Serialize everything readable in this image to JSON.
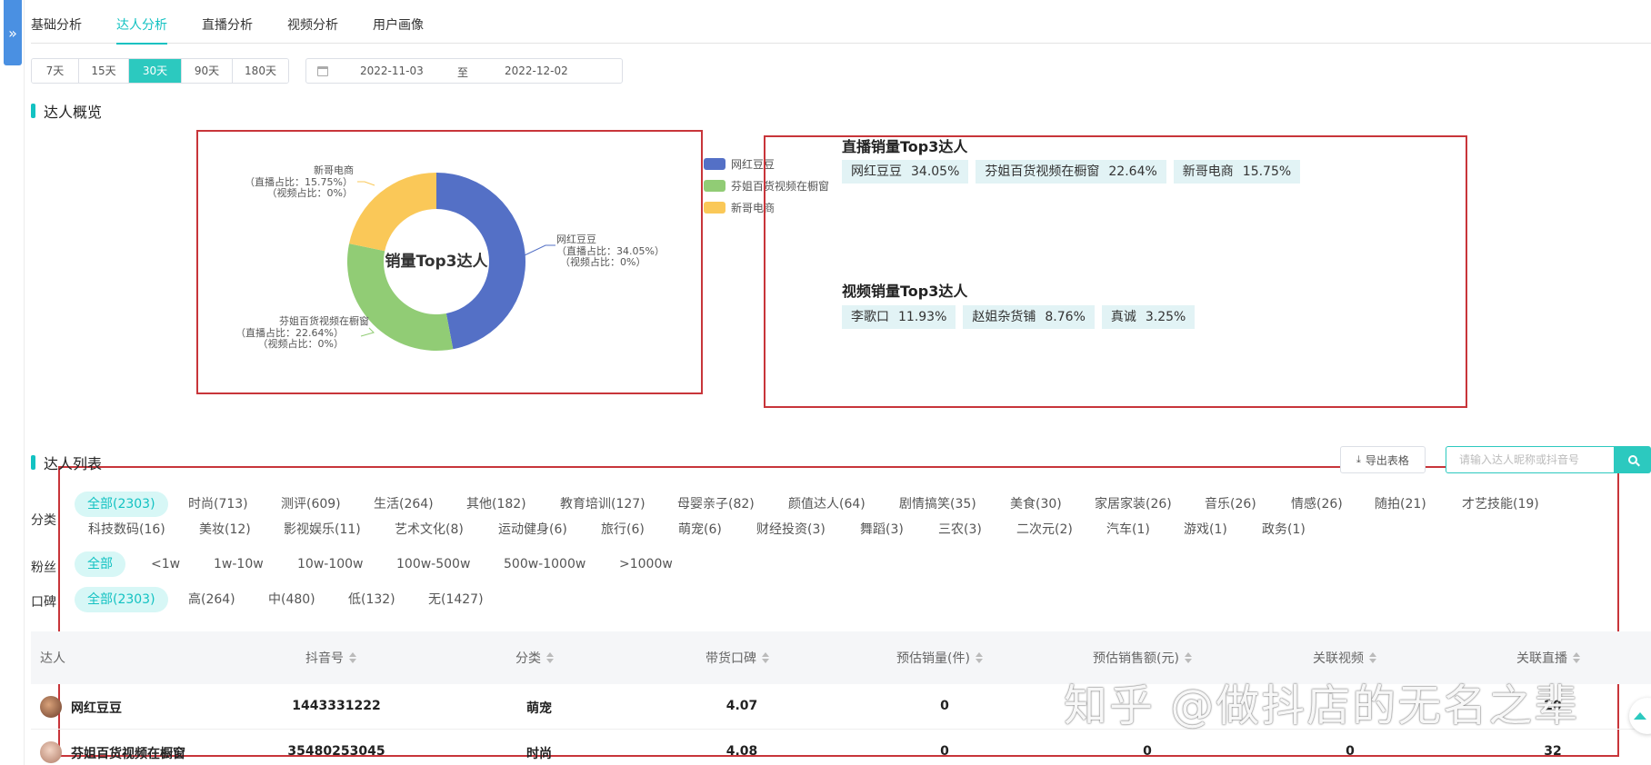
{
  "nav_tabs": [
    "基础分析",
    "达人分析",
    "直播分析",
    "视频分析",
    "用户画像"
  ],
  "nav_active": 1,
  "time_ranges": [
    "7天",
    "15天",
    "30天",
    "90天",
    "180天"
  ],
  "time_range_active": 2,
  "date_range": {
    "start": "2022-11-03",
    "separator": "至",
    "end": "2022-12-02"
  },
  "overview": {
    "title": "达人概览",
    "chart": {
      "center_label": "销量Top3达人",
      "legend": [
        "网红豆豆",
        "芬姐百货视频在橱窗",
        "新哥电商"
      ],
      "slices": [
        {
          "name": "网红豆豆",
          "line1": "（直播占比：34.05%）",
          "line2": "（视频占比：0%）"
        },
        {
          "name": "芬姐百货视频在橱窗",
          "line1": "（直播占比：22.64%）",
          "line2": "（视频占比：0%）"
        },
        {
          "name": "新哥电商",
          "line1": "（直播占比：15.75%）",
          "line2": "（视频占比：0%）"
        }
      ]
    },
    "live_top3": {
      "title": "直播销量Top3达人",
      "items": [
        {
          "name": "网红豆豆",
          "pct": "34.05%"
        },
        {
          "name": "芬姐百货视频在橱窗",
          "pct": "22.64%"
        },
        {
          "name": "新哥电商",
          "pct": "15.75%"
        }
      ]
    },
    "video_top3": {
      "title": "视频销量Top3达人",
      "items": [
        {
          "name": "李歌口",
          "pct": "11.93%"
        },
        {
          "name": "赵姐杂货铺",
          "pct": "8.76%"
        },
        {
          "name": "真诚",
          "pct": "3.25%"
        }
      ]
    }
  },
  "list": {
    "title": "达人列表",
    "export_label": "导出表格",
    "search_placeholder": "请输入达人昵称或抖音号"
  },
  "filters": {
    "category": {
      "label": "分类",
      "row1": [
        "全部(2303)",
        "时尚(713)",
        "测评(609)",
        "生活(264)",
        "其他(182)",
        "教育培训(127)",
        "母婴亲子(82)",
        "颜值达人(64)",
        "剧情搞笑(35)",
        "美食(30)",
        "家居家装(26)",
        "音乐(26)",
        "情感(26)",
        "随拍(21)",
        "才艺技能(19)"
      ],
      "row2": [
        "科技数码(16)",
        "美妆(12)",
        "影视娱乐(11)",
        "艺术文化(8)",
        "运动健身(6)",
        "旅行(6)",
        "萌宠(6)",
        "财经投资(3)",
        "舞蹈(3)",
        "三农(3)",
        "二次元(2)",
        "汽车(1)",
        "游戏(1)",
        "政务(1)"
      ]
    },
    "fans": {
      "label": "粉丝",
      "items": [
        "全部",
        "<1w",
        "1w-10w",
        "10w-100w",
        "100w-500w",
        "500w-1000w",
        ">1000w"
      ]
    },
    "reputation": {
      "label": "口碑",
      "items": [
        "全部(2303)",
        "高(264)",
        "中(480)",
        "低(132)",
        "无(1427)"
      ]
    }
  },
  "table": {
    "columns": [
      "达人",
      "抖音号",
      "分类",
      "带货口碑",
      "预估销量(件)",
      "预估销售额(元)",
      "关联视频",
      "关联直播"
    ],
    "rows": [
      [
        "网红豆豆",
        "1443331222",
        "萌宠",
        "4.07",
        "0",
        "",
        "",
        "20"
      ],
      [
        "芬姐百货视频在橱窗",
        "35480253045",
        "时尚",
        "4.08",
        "0",
        "0",
        "0",
        "32"
      ]
    ]
  },
  "watermark": "知乎 @做抖店的无名之辈",
  "colors": {
    "accent": "#13c2c2",
    "slice_blue": "#5470c6",
    "slice_green": "#91cc75",
    "slice_yellow": "#fac858",
    "annotation_red": "#c8353a"
  },
  "donut_values": [
    34.05,
    22.64,
    15.75
  ]
}
